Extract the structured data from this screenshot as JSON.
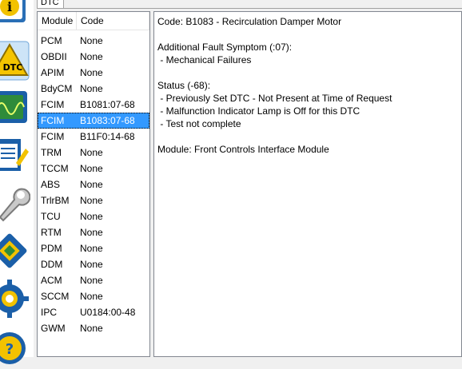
{
  "tab": {
    "label": "DTC"
  },
  "list": {
    "headers": {
      "module": "Module",
      "code": "Code"
    },
    "rows": [
      {
        "module": "PCM",
        "code": "None"
      },
      {
        "module": "OBDII",
        "code": "None"
      },
      {
        "module": "APIM",
        "code": "None"
      },
      {
        "module": "BdyCM",
        "code": "None"
      },
      {
        "module": "FCIM",
        "code": "B1081:07-68"
      },
      {
        "module": "FCIM",
        "code": "B1083:07-68"
      },
      {
        "module": "FCIM",
        "code": "B11F0:14-68"
      },
      {
        "module": "TRM",
        "code": "None"
      },
      {
        "module": "TCCM",
        "code": "None"
      },
      {
        "module": "ABS",
        "code": "None"
      },
      {
        "module": "TrlrBM",
        "code": "None"
      },
      {
        "module": "TCU",
        "code": "None"
      },
      {
        "module": "RTM",
        "code": "None"
      },
      {
        "module": "PDM",
        "code": "None"
      },
      {
        "module": "DDM",
        "code": "None"
      },
      {
        "module": "ACM",
        "code": "None"
      },
      {
        "module": "SCCM",
        "code": "None"
      },
      {
        "module": "IPC",
        "code": "U0184:00-48"
      },
      {
        "module": "GWM",
        "code": "None"
      }
    ]
  },
  "detail": {
    "code_line": "Code: B1083 - Recirculation Damper Motor",
    "symptom_title": "Additional Fault Symptom (:07):",
    "symptom_item": " - Mechanical Failures",
    "status_title": "Status (-68):",
    "status_items": [
      " - Previously Set DTC - Not Present at Time of Request",
      " - Malfunction Indicator Lamp is Off for this DTC",
      " - Test not complete"
    ],
    "module_line": "Module: Front Controls Interface Module"
  },
  "sidebar": {
    "icons": [
      "info-icon",
      "dtc-warning-icon",
      "oscilloscope-icon",
      "notepad-icon",
      "wrench-icon",
      "chip-icon",
      "settings-gear-icon",
      "help-icon"
    ]
  }
}
